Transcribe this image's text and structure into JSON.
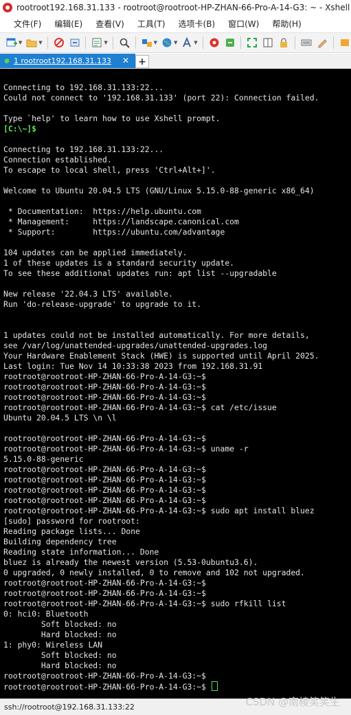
{
  "window": {
    "title": "rootroot192.168.31.133 - rootroot@rootroot-HP-ZHAN-66-Pro-A-14-G3: ~ - Xshell 7"
  },
  "menu": {
    "file": "文件(F)",
    "edit": "编辑(E)",
    "view": "查看(V)",
    "tools": "工具(T)",
    "tabs": "选项卡(B)",
    "window": "窗口(W)",
    "help": "帮助(H)"
  },
  "toolbar": {
    "icons": [
      "new-session-icon",
      "open-folder-icon",
      "disconnect-icon",
      "reconnect-icon",
      "properties-icon",
      "find-icon",
      "transfer-icon",
      "globe-icon",
      "font-icon",
      "xftp-icon",
      "tunnel-icon",
      "fullscreen-icon",
      "lock-icon",
      "keyboard-icon",
      "highlight-icon",
      "compose-icon"
    ]
  },
  "tab": {
    "label": "1 rootroot192.168.31.133",
    "status_color": "#56d35b",
    "accent": "#1f7fd1"
  },
  "terminal": {
    "lines": [
      {
        "text": "Connecting to 192.168.31.133:22..."
      },
      {
        "text": "Could not connect to '192.168.31.133' (port 22): Connection failed."
      },
      {
        "text": ""
      },
      {
        "text": "Type `help' to learn how to use Xshell prompt."
      },
      {
        "text": "[C:\\~]$",
        "color": "green"
      },
      {
        "text": ""
      },
      {
        "text": "Connecting to 192.168.31.133:22..."
      },
      {
        "text": "Connection established."
      },
      {
        "text": "To escape to local shell, press 'Ctrl+Alt+]'."
      },
      {
        "text": ""
      },
      {
        "text": "Welcome to Ubuntu 20.04.5 LTS (GNU/Linux 5.15.0-88-generic x86_64)"
      },
      {
        "text": ""
      },
      {
        "text": " * Documentation:  https://help.ubuntu.com"
      },
      {
        "text": " * Management:     https://landscape.canonical.com"
      },
      {
        "text": " * Support:        https://ubuntu.com/advantage"
      },
      {
        "text": ""
      },
      {
        "text": "104 updates can be applied immediately."
      },
      {
        "text": "1 of these updates is a standard security update."
      },
      {
        "text": "To see these additional updates run: apt list --upgradable"
      },
      {
        "text": ""
      },
      {
        "text": "New release '22.04.3 LTS' available."
      },
      {
        "text": "Run 'do-release-upgrade' to upgrade to it."
      },
      {
        "text": ""
      },
      {
        "text": ""
      },
      {
        "text": "1 updates could not be installed automatically. For more details,"
      },
      {
        "text": "see /var/log/unattended-upgrades/unattended-upgrades.log"
      },
      {
        "text": "Your Hardware Enablement Stack (HWE) is supported until April 2025."
      },
      {
        "text": "Last login: Tue Nov 14 10:33:38 2023 from 192.168.31.91"
      },
      {
        "text": "rootroot@rootroot-HP-ZHAN-66-Pro-A-14-G3:~$"
      },
      {
        "text": "rootroot@rootroot-HP-ZHAN-66-Pro-A-14-G3:~$"
      },
      {
        "text": "rootroot@rootroot-HP-ZHAN-66-Pro-A-14-G3:~$"
      },
      {
        "text": "rootroot@rootroot-HP-ZHAN-66-Pro-A-14-G3:~$ cat /etc/issue"
      },
      {
        "text": "Ubuntu 20.04.5 LTS \\n \\l"
      },
      {
        "text": ""
      },
      {
        "text": "rootroot@rootroot-HP-ZHAN-66-Pro-A-14-G3:~$"
      },
      {
        "text": "rootroot@rootroot-HP-ZHAN-66-Pro-A-14-G3:~$ uname -r"
      },
      {
        "text": "5.15.0-88-generic"
      },
      {
        "text": "rootroot@rootroot-HP-ZHAN-66-Pro-A-14-G3:~$"
      },
      {
        "text": "rootroot@rootroot-HP-ZHAN-66-Pro-A-14-G3:~$"
      },
      {
        "text": "rootroot@rootroot-HP-ZHAN-66-Pro-A-14-G3:~$"
      },
      {
        "text": "rootroot@rootroot-HP-ZHAN-66-Pro-A-14-G3:~$"
      },
      {
        "text": "rootroot@rootroot-HP-ZHAN-66-Pro-A-14-G3:~$ sudo apt install bluez"
      },
      {
        "text": "[sudo] password for rootroot:"
      },
      {
        "text": "Reading package lists... Done"
      },
      {
        "text": "Building dependency tree"
      },
      {
        "text": "Reading state information... Done"
      },
      {
        "text": "bluez is already the newest version (5.53-0ubuntu3.6)."
      },
      {
        "text": "0 upgraded, 0 newly installed, 0 to remove and 102 not upgraded."
      },
      {
        "text": "rootroot@rootroot-HP-ZHAN-66-Pro-A-14-G3:~$"
      },
      {
        "text": "rootroot@rootroot-HP-ZHAN-66-Pro-A-14-G3:~$"
      },
      {
        "text": "rootroot@rootroot-HP-ZHAN-66-Pro-A-14-G3:~$ sudo rfkill list"
      },
      {
        "text": "0: hci0: Bluetooth"
      },
      {
        "text": "        Soft blocked: no"
      },
      {
        "text": "        Hard blocked: no"
      },
      {
        "text": "1: phy0: Wireless LAN"
      },
      {
        "text": "        Soft blocked: no"
      },
      {
        "text": "        Hard blocked: no"
      },
      {
        "text": "rootroot@rootroot-HP-ZHAN-66-Pro-A-14-G3:~$"
      },
      {
        "text": "rootroot@rootroot-HP-ZHAN-66-Pro-A-14-G3:~$ ",
        "cursor": true
      }
    ],
    "background": "#000000",
    "foreground": "#e6e6e6",
    "prompt_color": "#5fe35f"
  },
  "status": {
    "connection": "ssh://rootroot@192.168.31.133:22"
  },
  "watermark": "CSDN @南棱笑笑生"
}
